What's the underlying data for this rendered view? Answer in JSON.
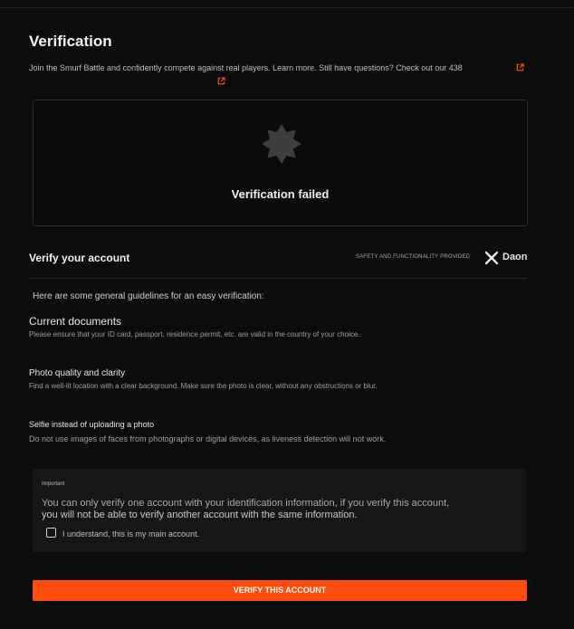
{
  "header": {
    "title": "Verification",
    "intro": "Join the Smurf Battle and confidently compete against real players. Learn more. Still have questions? Check out our 438"
  },
  "status": {
    "text": "Verification failed"
  },
  "verify": {
    "heading": "Verify your account",
    "provider_label": "SAFETY AND FUNCTIONALITY PROVIDED",
    "provider_name": "Daon"
  },
  "guidelines": {
    "intro": "Here are some general guidelines for an easy verification:",
    "items": [
      {
        "title": "Current documents",
        "text": "Please ensure that your ID card, passport, residence permit, etc. are valid in the country of your choice."
      },
      {
        "title": "Photo quality and clarity",
        "text": "Find a well-lit location with a clear background. Make sure the photo is clear, without any obstructions or blur."
      },
      {
        "title": "Selfie instead of uploading a photo",
        "text": "Do not use images of faces from photographs or digital devices, as liveness detection will not work."
      }
    ]
  },
  "important": {
    "label": "Important",
    "line1": "You can only verify one account with your identification information, if you verify this account,",
    "line2": "you will not be able to verify another account with the same information.",
    "checkbox_label": "I understand, this is my main account."
  },
  "cta": {
    "label": "VERIFY THIS ACCOUNT"
  },
  "colors": {
    "accent": "#ff4d0d",
    "background": "#0c0c0c",
    "panel": "#161616"
  },
  "icons": [
    "external-link-icon",
    "verification-badge-icon",
    "daon-x-logo-icon",
    "checkbox"
  ]
}
